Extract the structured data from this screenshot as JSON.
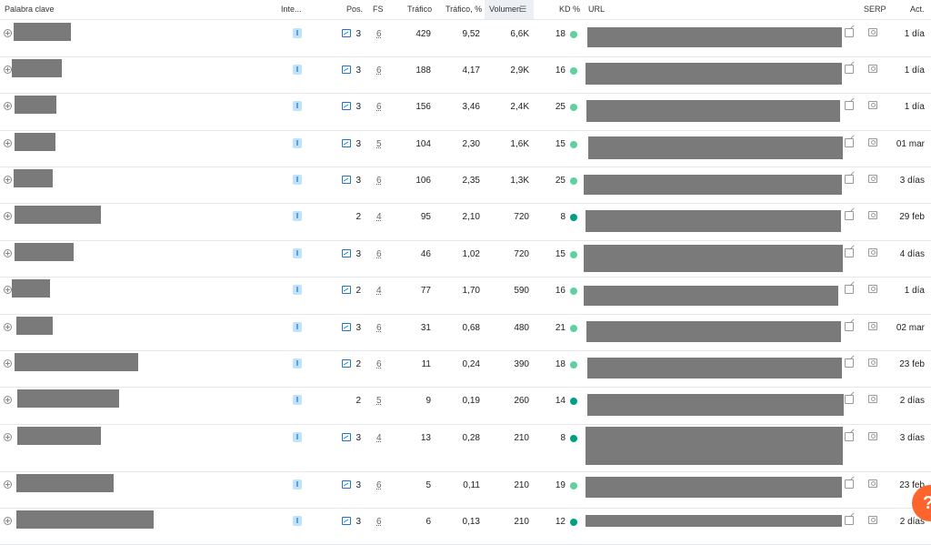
{
  "columns": {
    "keyword": "Palabra clave",
    "intent": "Inte...",
    "position": "Pos.",
    "fs": "FS",
    "traffic": "Tráfico",
    "traffic_pct": "Tráfico, %",
    "volume": "Volumen",
    "kd": "KD %",
    "url": "URL",
    "serp": "SERP",
    "updated": "Act."
  },
  "colors": {
    "kd_easy": "#5ed19f",
    "kd_hard": "#009f81",
    "help": "#ff642d"
  },
  "rows": [
    {
      "intent": "I",
      "serp_image": true,
      "pos": "3",
      "fs": "6",
      "traffic": "429",
      "traffic_pct": "9,52",
      "volume": "6,6K",
      "kd": "18",
      "kd_level": "easy",
      "updated": "1 día"
    },
    {
      "intent": "I",
      "serp_image": true,
      "pos": "3",
      "fs": "6",
      "traffic": "188",
      "traffic_pct": "4,17",
      "volume": "2,9K",
      "kd": "16",
      "kd_level": "easy",
      "updated": "1 día"
    },
    {
      "intent": "I",
      "serp_image": true,
      "pos": "3",
      "fs": "6",
      "traffic": "156",
      "traffic_pct": "3,46",
      "volume": "2,4K",
      "kd": "25",
      "kd_level": "easy",
      "updated": "1 día"
    },
    {
      "intent": "I",
      "serp_image": true,
      "pos": "3",
      "fs": "5",
      "traffic": "104",
      "traffic_pct": "2,30",
      "volume": "1,6K",
      "kd": "15",
      "kd_level": "easy",
      "updated": "01 mar"
    },
    {
      "intent": "I",
      "serp_image": true,
      "pos": "3",
      "fs": "6",
      "traffic": "106",
      "traffic_pct": "2,35",
      "volume": "1,3K",
      "kd": "25",
      "kd_level": "easy",
      "updated": "3 días"
    },
    {
      "intent": "I",
      "serp_image": false,
      "pos": "2",
      "fs": "4",
      "traffic": "95",
      "traffic_pct": "2,10",
      "volume": "720",
      "kd": "8",
      "kd_level": "hard",
      "updated": "29 feb"
    },
    {
      "intent": "I",
      "serp_image": true,
      "pos": "3",
      "fs": "6",
      "traffic": "46",
      "traffic_pct": "1,02",
      "volume": "720",
      "kd": "15",
      "kd_level": "easy",
      "updated": "4 días"
    },
    {
      "intent": "I",
      "serp_image": true,
      "pos": "2",
      "fs": "4",
      "traffic": "77",
      "traffic_pct": "1,70",
      "volume": "590",
      "kd": "16",
      "kd_level": "easy",
      "updated": "1 día"
    },
    {
      "intent": "I",
      "serp_image": true,
      "pos": "3",
      "fs": "6",
      "traffic": "31",
      "traffic_pct": "0,68",
      "volume": "480",
      "kd": "21",
      "kd_level": "easy",
      "updated": "02 mar"
    },
    {
      "intent": "I",
      "serp_image": true,
      "pos": "2",
      "fs": "6",
      "traffic": "11",
      "traffic_pct": "0,24",
      "volume": "390",
      "kd": "18",
      "kd_level": "easy",
      "updated": "23 feb"
    },
    {
      "intent": "I",
      "serp_image": false,
      "pos": "2",
      "fs": "5",
      "traffic": "9",
      "traffic_pct": "0,19",
      "volume": "260",
      "kd": "14",
      "kd_level": "hard",
      "updated": "2 días"
    },
    {
      "intent": "I",
      "serp_image": true,
      "pos": "3",
      "fs": "4",
      "traffic": "13",
      "traffic_pct": "0,28",
      "volume": "210",
      "kd": "8",
      "kd_level": "hard",
      "updated": "3 días"
    },
    {
      "intent": "I",
      "serp_image": true,
      "pos": "3",
      "fs": "6",
      "traffic": "5",
      "traffic_pct": "0,11",
      "volume": "210",
      "kd": "19",
      "kd_level": "easy",
      "updated": "23 feb"
    },
    {
      "intent": "I",
      "serp_image": true,
      "pos": "3",
      "fs": "6",
      "traffic": "6",
      "traffic_pct": "0,13",
      "volume": "210",
      "kd": "12",
      "kd_level": "hard",
      "updated": "2 días"
    }
  ],
  "help_label": "?"
}
